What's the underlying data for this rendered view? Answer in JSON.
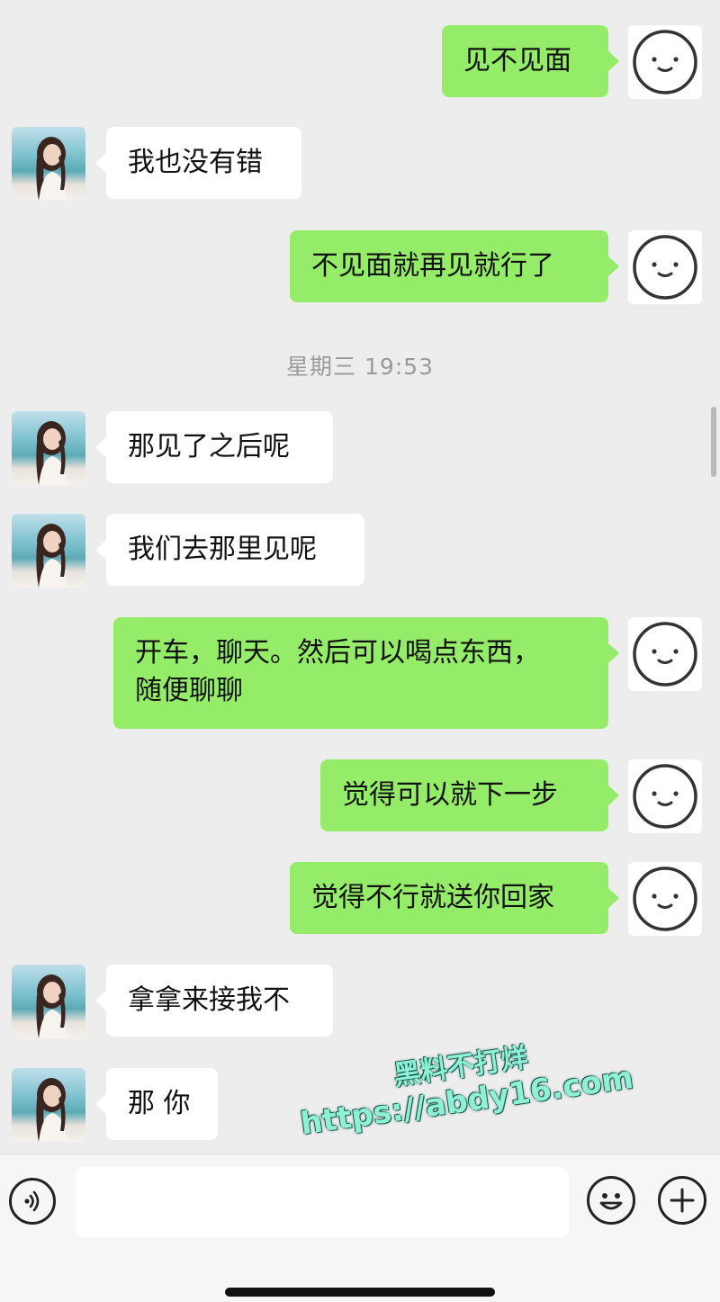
{
  "messages": [
    {
      "sender": "me",
      "text": "见不见面"
    },
    {
      "sender": "her",
      "text": "我也没有错"
    },
    {
      "sender": "me",
      "text": "不见面就再见就行了"
    },
    {
      "sender": "her",
      "text": "那见了之后呢"
    },
    {
      "sender": "her",
      "text": "我们去那里见呢"
    },
    {
      "sender": "me",
      "text": "开车，聊天。然后可以喝点东西，\n随便聊聊"
    },
    {
      "sender": "me",
      "text": "觉得可以就下一步"
    },
    {
      "sender": "me",
      "text": "觉得不行就送你回家"
    },
    {
      "sender": "her",
      "text": "拿拿来接我不"
    },
    {
      "sender": "her",
      "text": "那 你"
    }
  ],
  "timestamp": "星期三 19:53",
  "watermark": {
    "line1": "黑料不打烊",
    "line2": "https://abdy16.com"
  },
  "input_bar": {
    "voice_icon": "voice-icon",
    "emoji_icon": "smiley-icon",
    "plus_icon": "plus-icon",
    "input_value": ""
  }
}
